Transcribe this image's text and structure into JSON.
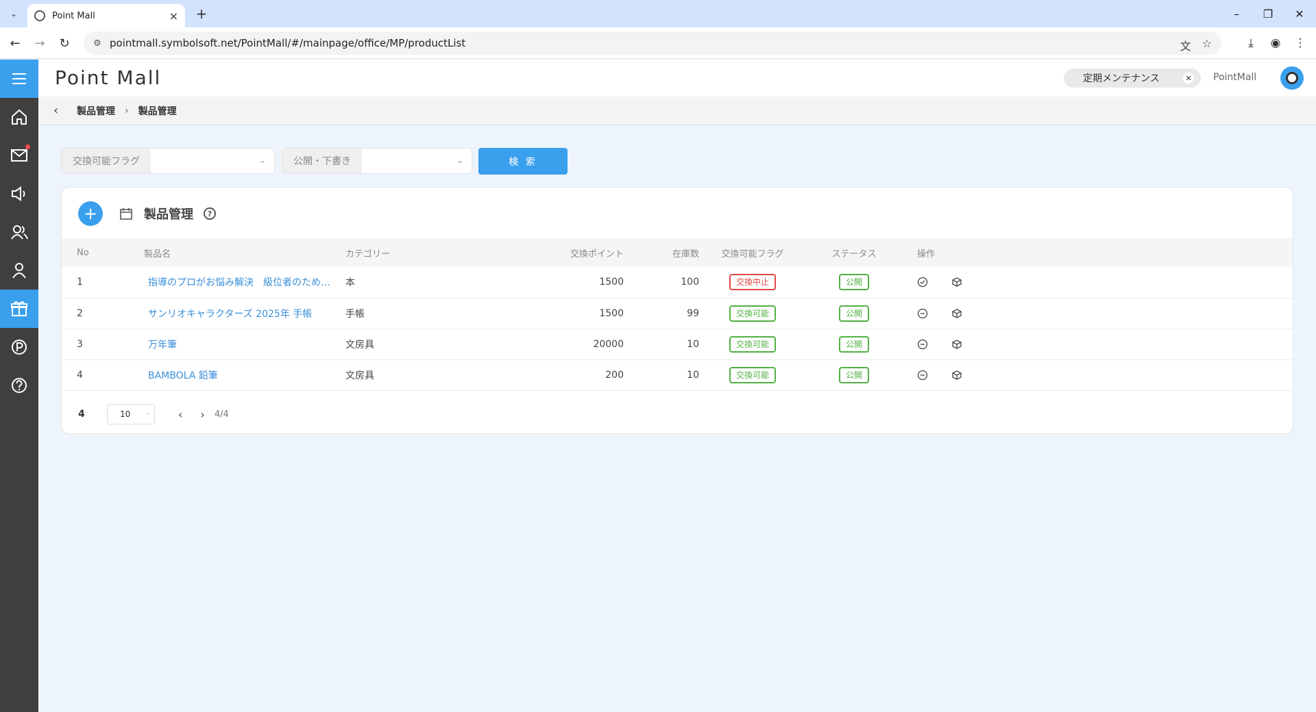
{
  "browser": {
    "tab_title": "Point Mall",
    "url": "pointmall.symbolsoft.net/PointMall/#/mainpage/office/MP/productList"
  },
  "header": {
    "app_title": "Point Mall",
    "maintenance_chip": "定期メンテナンス",
    "user_name": "PointMall"
  },
  "breadcrumb": [
    "製品管理",
    "製品管理"
  ],
  "filters": {
    "exchange_flag_label": "交換可能フラグ",
    "publish_label": "公開・下書き",
    "search_button": "検 索"
  },
  "card": {
    "title": "製品管理"
  },
  "table": {
    "columns": [
      "No",
      "製品名",
      "カテゴリー",
      "交換ポイント",
      "在庫数",
      "交換可能フラグ",
      "ステータス",
      "操作"
    ],
    "rows": [
      {
        "no": "1",
        "name": "指導のプロがお悩み解決　級位者のための…",
        "category": "本",
        "points": "1500",
        "stock": "100",
        "flag": "交換中止",
        "flag_color": "red",
        "status": "公開"
      },
      {
        "no": "2",
        "name": "サンリオキャラクターズ 2025年 手帳",
        "category": "手帳",
        "points": "1500",
        "stock": "99",
        "flag": "交換可能",
        "flag_color": "green",
        "status": "公開"
      },
      {
        "no": "3",
        "name": "万年筆",
        "category": "文房具",
        "points": "20000",
        "stock": "10",
        "flag": "交換可能",
        "flag_color": "green",
        "status": "公開"
      },
      {
        "no": "4",
        "name": "BAMBOLA 鉛筆",
        "category": "文房具",
        "points": "200",
        "stock": "10",
        "flag": "交換可能",
        "flag_color": "green",
        "status": "公開"
      }
    ]
  },
  "pager": {
    "total": "4",
    "page_size": "10",
    "page_info": "4/4"
  },
  "colors": {
    "accent": "#3aa0ee",
    "sidebar": "#3f3f3f",
    "badge_red": "#e04545",
    "badge_green": "#52b043"
  }
}
